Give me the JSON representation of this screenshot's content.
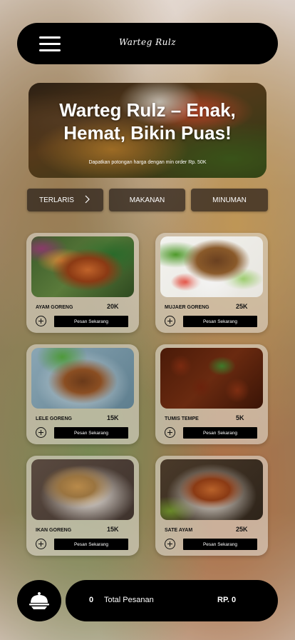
{
  "header": {
    "brand": "Warteg Rulz"
  },
  "hero": {
    "title_line1": "Warteg Rulz – Enak,",
    "title_line2": "Hemat, Bikin Puas!",
    "subtitle": "Dapatkan potongan harga dengan min order Rp. 50K"
  },
  "tabs": [
    {
      "label": "TERLARIS"
    },
    {
      "label": "MAKANAN"
    },
    {
      "label": "MINUMAN"
    }
  ],
  "menu": [
    {
      "name": "AYAM GORENG",
      "price": "20K",
      "button": "Pesan Sekarang"
    },
    {
      "name": "MUJAER GORENG",
      "price": "25K",
      "button": "Pesan Sekarang"
    },
    {
      "name": "LELE GORENG",
      "price": "15K",
      "button": "Pesan Sekarang"
    },
    {
      "name": "TUMIS TEMPE",
      "price": "5K",
      "button": "Pesan Sekarang"
    },
    {
      "name": "IKAN GORENG",
      "price": "15K",
      "button": "Pesan Sekarang"
    },
    {
      "name": "SATE AYAM",
      "price": "25K",
      "button": "Pesan Sekarang"
    }
  ],
  "cart": {
    "count": "0",
    "label": "Total Pesanan",
    "price": "RP. 0"
  }
}
